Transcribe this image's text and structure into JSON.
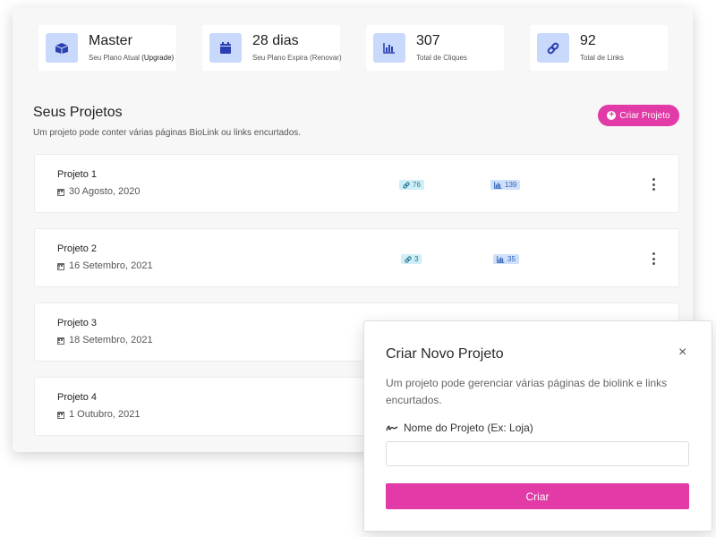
{
  "stats": [
    {
      "value": "Master",
      "label": "Seu Plano Atual",
      "extra": "(Upgrade)",
      "icon": "box-icon"
    },
    {
      "value": "28 dias",
      "label": "Seu Plano Expira (Renovar)",
      "extra": "",
      "icon": "calendar-icon"
    },
    {
      "value": "307",
      "label": "Total de Cliques",
      "extra": "",
      "icon": "bar-chart-icon"
    },
    {
      "value": "92",
      "label": "Total de Links",
      "extra": "",
      "icon": "link-icon"
    }
  ],
  "section": {
    "title": "Seus Projetos",
    "subtitle": "Um projeto pode conter várias páginas BioLink ou links encurtados.",
    "create_button": "Criar Projeto"
  },
  "projects": [
    {
      "name": "Projeto 1",
      "date": "30 Agosto, 2020",
      "links": "76",
      "clicks": "139"
    },
    {
      "name": "Projeto 2",
      "date": "16 Setembro, 2021",
      "links": "3",
      "clicks": "35"
    },
    {
      "name": "Projeto 3",
      "date": "18 Setembro, 2021"
    },
    {
      "name": "Projeto 4",
      "date": "1 Outubro, 2021"
    }
  ],
  "modal": {
    "title": "Criar Novo Projeto",
    "close": "×",
    "description": "Um projeto pode gerenciar várias páginas de biolink e links encurtados.",
    "field_label": "Nome do Projeto (Ex: Loja)",
    "field_value": "",
    "submit_label": "Criar"
  },
  "colors": {
    "accent": "#e23aa7",
    "icon_bg": "#c9d9fb",
    "icon_fg": "#2b3fb0"
  }
}
